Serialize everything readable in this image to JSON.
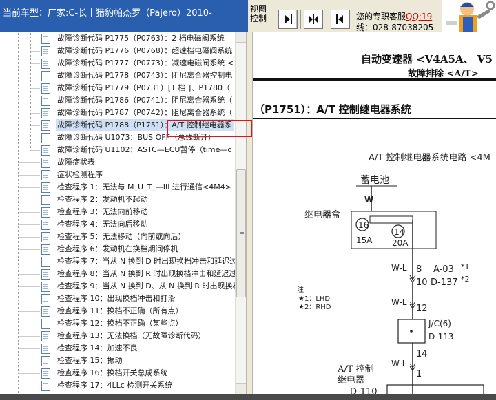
{
  "window": {
    "title": "当前车型：厂家:C-长丰猎豹帕杰罗（Pajero）2010-"
  },
  "toolbar": {
    "view_control_label": "视图控制",
    "buttons": [
      "prev-section",
      "expand-collapse",
      "next-section"
    ]
  },
  "support": {
    "line1_prefix": "您的专职客服",
    "qq": "QQ:19",
    "line2": "线：028-87038205"
  },
  "tree": {
    "items": [
      {
        "label": "故障诊断代码 P1775（P0763）：2 档电磁阀系统",
        "level": 2
      },
      {
        "label": "故障诊断代码 P1776（P0768）：超速档电磁阀系统",
        "level": 2
      },
      {
        "label": "故障诊断代码 P1777（P0773）：减速电磁阀系统 <",
        "level": 2
      },
      {
        "label": "故障诊断代码 P1778（P0743）：阻尼离合器控制电",
        "level": 2
      },
      {
        "label": "故障诊断代码 P1779（P0731）[1 档 ]、P1780（",
        "level": 2
      },
      {
        "label": "故障诊断代码 P1786（P0741）：阻尼离合器系统（",
        "level": 2
      },
      {
        "label": "故障诊断代码 P1787（P0742）：阻尼离合器系统（",
        "level": 2
      },
      {
        "label": "故障诊断代码 P1788（P1751）：A/T 控制继电器系",
        "level": 2,
        "selected": true
      },
      {
        "label": "故障诊断代码 U1073：BUS OFF（总线断开）",
        "level": 2
      },
      {
        "label": "故障诊断代码 U1102：ASTC—ECU暂停（time—c",
        "level": 2
      },
      {
        "label": "故障症状表",
        "level": 1
      },
      {
        "label": "症状检测程序",
        "level": 1
      },
      {
        "label": "检查程序 1：无法与 M_U_T_—III 进行通信<4M4>",
        "level": 1
      },
      {
        "label": "检查程序 2：发动机不起动",
        "level": 1
      },
      {
        "label": "检查程序 3：无法向前移动",
        "level": 1
      },
      {
        "label": "检查程序 4：无法向后移动",
        "level": 1
      },
      {
        "label": "检查程序 5：无法移动（向前或向后）",
        "level": 1
      },
      {
        "label": "检查程序 6：发动机在换档期间停机",
        "level": 1
      },
      {
        "label": "检查程序 7：当从 N 换到 D 时出现换档冲击和延迟过",
        "level": 1
      },
      {
        "label": "检查程序 8：当从 N 换到 R 时出现换档冲击和延迟过",
        "level": 1
      },
      {
        "label": "检查程序 9：当从 N 换到 D、从 N 换到 R 时出现换档",
        "level": 1
      },
      {
        "label": "检查程序 10：出现换档冲击和打滑",
        "level": 1
      },
      {
        "label": "检查程序 11：换档不正确（所有点）",
        "level": 1
      },
      {
        "label": "检查程序 12：换档不正确（某些点）",
        "level": 1
      },
      {
        "label": "检查程序 13：无法换档（无故障诊断代码）",
        "level": 1
      },
      {
        "label": "检查程序 14：加速不良",
        "level": 1
      },
      {
        "label": "检查程序 15：振动",
        "level": 1
      },
      {
        "label": "检查程序 16：换档开关总成系统",
        "level": 1
      },
      {
        "label": "检查程序 17：4LLc 检测开关系统",
        "level": 1
      }
    ]
  },
  "document": {
    "heading": "自动变速器 <V4A5A、 V5",
    "subheading": "故障排除 <A/T>",
    "section_title": "（P1751）：A/T 控制继电器系统",
    "diagram": {
      "title": "A/T 控制继电器系统电路 <4M",
      "battery": "蓄电池",
      "wire_w": "W",
      "relay_box": "继电器盒",
      "fuse_left_num": "16",
      "fuse_left_amp": "15A",
      "fuse_right_num": "14",
      "fuse_right_amp": "20A",
      "wire_wl": "W-L",
      "pin_8": "8",
      "conn_a03": "A-03",
      "mark_1": "*1",
      "pin_10": "10",
      "conn_d137": "D-137",
      "mark_2": "*2",
      "note_title": "注",
      "note_1": "★1：LHD",
      "note_2": "★2：RHD",
      "pin_12": "12",
      "jc_label": "J/C(6)",
      "jc_conn": "D-113",
      "pin_14": "14",
      "relay_label_1": "A/T 控制",
      "relay_label_2": "继电器",
      "pin_1": "1",
      "conn_d110": "D-110"
    }
  }
}
